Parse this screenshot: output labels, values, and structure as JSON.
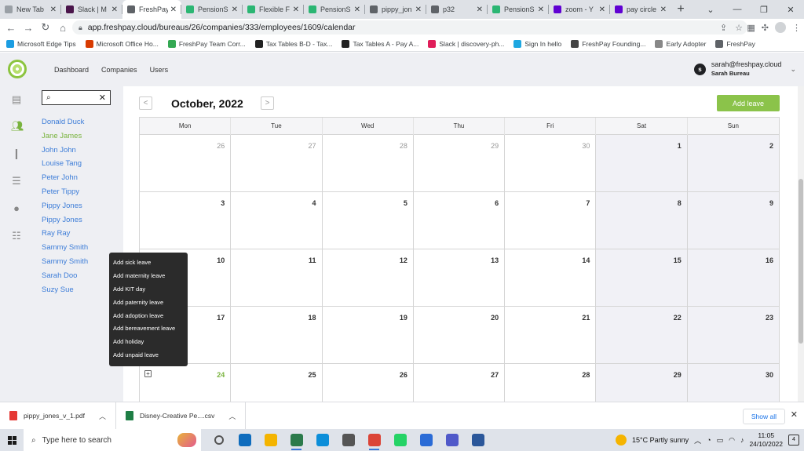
{
  "browser": {
    "tabs": [
      {
        "title": "New Tab",
        "color": "#9aa0a6"
      },
      {
        "title": "Slack | M",
        "color": "#4a154b"
      },
      {
        "title": "FreshPay",
        "color": "#5f6368",
        "active": true
      },
      {
        "title": "PensionS",
        "color": "#2bb673"
      },
      {
        "title": "Flexible F",
        "color": "#2bb673"
      },
      {
        "title": "PensionS",
        "color": "#2bb673"
      },
      {
        "title": "pippy_jon",
        "color": "#5f6368"
      },
      {
        "title": "p32",
        "color": "#5f6368"
      },
      {
        "title": "PensionS",
        "color": "#2bb673"
      },
      {
        "title": "zoom - Y",
        "color": "#6001d2"
      },
      {
        "title": "pay circle",
        "color": "#6001d2"
      }
    ],
    "url": "app.freshpay.cloud/bureaus/26/companies/333/employees/1609/calendar",
    "bookmarks": [
      {
        "label": "Microsoft Edge Tips",
        "color": "#1b9de2"
      },
      {
        "label": "Microsoft Office Ho...",
        "color": "#d83b01"
      },
      {
        "label": "FreshPay Team Corr...",
        "color": "#34a853"
      },
      {
        "label": "Tax Tables B-D - Tax...",
        "color": "#222222"
      },
      {
        "label": "Tax Tables A - Pay A...",
        "color": "#222222"
      },
      {
        "label": "Slack | discovery-ph...",
        "color": "#e01e5a"
      },
      {
        "label": "Sign In hello",
        "color": "#1ea7e1"
      },
      {
        "label": "FreshPay Founding...",
        "color": "#444444"
      },
      {
        "label": "Early Adopter",
        "color": "#888888"
      },
      {
        "label": "FreshPay",
        "color": "#5f6368"
      }
    ]
  },
  "app": {
    "nav": [
      "Dashboard",
      "Companies",
      "Users"
    ],
    "user": {
      "initial": "s",
      "email": "sarah@freshpay.cloud",
      "name": "Sarah Bureau"
    },
    "brand_color": "#8bc34a"
  },
  "employees": {
    "search_value": "",
    "list": [
      {
        "name": "Donald Duck"
      },
      {
        "name": "Jane James",
        "active": true
      },
      {
        "name": "John John"
      },
      {
        "name": "Louise Tang"
      },
      {
        "name": "Peter John"
      },
      {
        "name": "Peter Tippy"
      },
      {
        "name": "Pippy Jones"
      },
      {
        "name": "Pippy Jones"
      },
      {
        "name": "Ray Ray"
      },
      {
        "name": "Sammy Smith"
      },
      {
        "name": "Sammy Smith"
      },
      {
        "name": "Sarah Doo"
      },
      {
        "name": "Suzy Sue"
      }
    ]
  },
  "calendar": {
    "month_label": "October, 2022",
    "add_leave_label": "Add leave",
    "prev_label": "<",
    "next_label": ">",
    "weekdays": [
      "Mon",
      "Tue",
      "Wed",
      "Thu",
      "Fri",
      "Sat",
      "Sun"
    ],
    "weeks": [
      [
        {
          "d": "26",
          "out": true
        },
        {
          "d": "27",
          "out": true
        },
        {
          "d": "28",
          "out": true
        },
        {
          "d": "29",
          "out": true
        },
        {
          "d": "30",
          "out": true
        },
        {
          "d": "1"
        },
        {
          "d": "2"
        }
      ],
      [
        {
          "d": "3"
        },
        {
          "d": "4"
        },
        {
          "d": "5"
        },
        {
          "d": "6"
        },
        {
          "d": "7"
        },
        {
          "d": "8"
        },
        {
          "d": "9"
        }
      ],
      [
        {
          "d": "10"
        },
        {
          "d": "11"
        },
        {
          "d": "12"
        },
        {
          "d": "13"
        },
        {
          "d": "14"
        },
        {
          "d": "15"
        },
        {
          "d": "16"
        }
      ],
      [
        {
          "d": "17"
        },
        {
          "d": "18"
        },
        {
          "d": "19"
        },
        {
          "d": "20"
        },
        {
          "d": "21"
        },
        {
          "d": "22"
        },
        {
          "d": "23"
        }
      ],
      [
        {
          "d": "24",
          "today": true
        },
        {
          "d": "25"
        },
        {
          "d": "26"
        },
        {
          "d": "27"
        },
        {
          "d": "28"
        },
        {
          "d": "29"
        },
        {
          "d": "30"
        }
      ]
    ],
    "context_menu": [
      "Add sick leave",
      "Add maternity leave",
      "Add KIT day",
      "Add paternity leave",
      "Add adoption leave",
      "Add bereavement leave",
      "Add holiday",
      "Add unpaid leave"
    ]
  },
  "downloads": {
    "items": [
      {
        "name": "pippy_jones_v_1.pdf",
        "color": "#e53935"
      },
      {
        "name": "Disney-Creative Pe....csv",
        "color": "#1e7e45"
      }
    ],
    "show_all": "Show all"
  },
  "taskbar": {
    "search_placeholder": "Type here to search",
    "weather": "15°C  Partly sunny",
    "time": "11:05",
    "date": "24/10/2022",
    "notifications": "4",
    "apps": [
      {
        "name": "task-view",
        "color": "#555555"
      },
      {
        "name": "mail",
        "color": "#0f6cbd"
      },
      {
        "name": "file-explorer",
        "color": "#f4b400"
      },
      {
        "name": "edge-dev",
        "color": "#2b7a4b",
        "active": true
      },
      {
        "name": "edge",
        "color": "#0c8ed9"
      },
      {
        "name": "store",
        "color": "#555555"
      },
      {
        "name": "chrome",
        "color": "#db4437",
        "active": true
      },
      {
        "name": "whatsapp",
        "color": "#25d366"
      },
      {
        "name": "calendar",
        "color": "#2a6bd6"
      },
      {
        "name": "teams",
        "color": "#5059c9"
      },
      {
        "name": "word",
        "color": "#2b579a"
      }
    ]
  }
}
